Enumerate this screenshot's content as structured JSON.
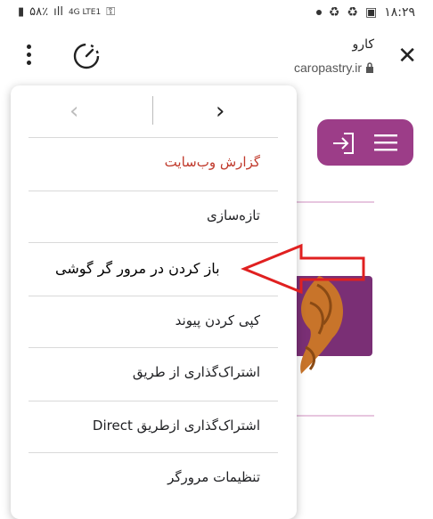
{
  "status_bar": {
    "time": "۱۸:۲۹",
    "battery": "۵۸٪",
    "network": "4G LTE1"
  },
  "toolbar": {
    "site_title": "کارو",
    "site_url": "caropastry.ir"
  },
  "popup": {
    "items": [
      {
        "label": "گزارش وب‌سایت"
      },
      {
        "label": "تازه‌سازی"
      },
      {
        "label": ""
      },
      {
        "label": "کپی کردن پیوند"
      },
      {
        "label": "اشتراک‌گذاری از طریق"
      },
      {
        "label": "اشتراک‌گذاری ازطریق Direct"
      },
      {
        "label": "تنظیمات مرورگر"
      }
    ]
  },
  "annotation": {
    "text": "باز کردن در مرور گر گوشی"
  },
  "colors": {
    "accent": "#9c3d88",
    "report": "#c0392b",
    "arrow": "#e02020"
  }
}
